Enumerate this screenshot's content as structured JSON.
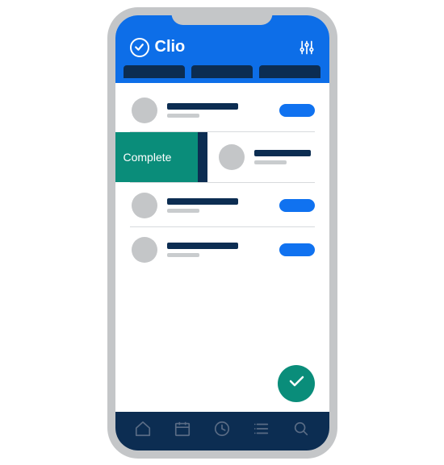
{
  "brand": {
    "name": "Clio"
  },
  "header": {
    "settings_icon": "sliders-icon"
  },
  "tabs": [
    {
      "id": "tab-1"
    },
    {
      "id": "tab-2"
    },
    {
      "id": "tab-3"
    }
  ],
  "list": {
    "swipe_action_label": "Complete",
    "items": [
      {
        "id": "item-1",
        "swiped": false,
        "has_pill": true
      },
      {
        "id": "item-2",
        "swiped": true,
        "has_pill": false
      },
      {
        "id": "item-3",
        "swiped": false,
        "has_pill": true
      },
      {
        "id": "item-4",
        "swiped": false,
        "has_pill": true
      }
    ]
  },
  "fab": {
    "icon": "check-icon"
  },
  "bottom_nav": [
    {
      "id": "home",
      "icon": "home-icon"
    },
    {
      "id": "calendar",
      "icon": "calendar-icon"
    },
    {
      "id": "clock",
      "icon": "clock-icon"
    },
    {
      "id": "list",
      "icon": "list-icon"
    },
    {
      "id": "search",
      "icon": "search-icon"
    }
  ],
  "colors": {
    "brand_blue": "#0d6ee8",
    "dark_navy": "#0c2d52",
    "teal": "#0a8d7a",
    "grey": "#c4c6c8"
  }
}
